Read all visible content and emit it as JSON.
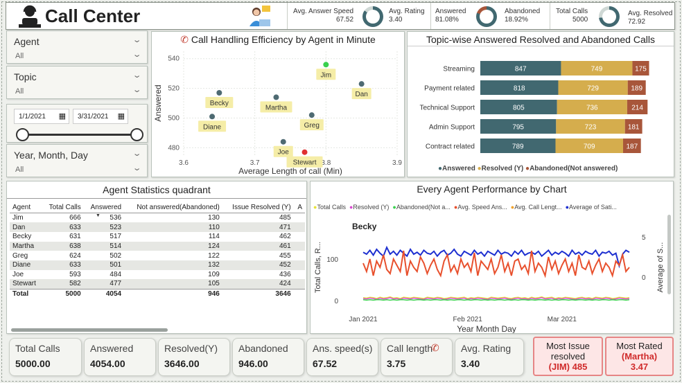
{
  "header": {
    "title": "Call Center",
    "kpis": [
      {
        "label": "Avg. Answer Speed",
        "value": "67.52",
        "label2": "Avg. Rating",
        "value2": "3.40"
      },
      {
        "label": "Answered",
        "value": "81.08%",
        "label2": "Abandoned",
        "value2": "18.92%"
      },
      {
        "label": "Total Calls",
        "value": "5000",
        "label2": "Avg. Resolved",
        "value2": "72.92"
      }
    ]
  },
  "filters": {
    "agent": {
      "title": "Agent",
      "value": "All"
    },
    "topic": {
      "title": "Topic",
      "value": "All"
    },
    "date_start": "1/1/2021",
    "date_end": "3/31/2021",
    "ymd": {
      "title": "Year, Month, Day",
      "value": "All"
    }
  },
  "scatter": {
    "title": "Call Handling Efficiency by Agent in Minute",
    "xlabel": "Average Length of call (Min)",
    "ylabel": "Answered",
    "xticks": [
      "3.6",
      "3.7",
      "3.8",
      "3.9"
    ],
    "yticks": [
      "480",
      "500",
      "520",
      "540"
    ]
  },
  "topic_chart": {
    "title": "Topic-wise Answered Resolved and Abandoned Calls",
    "legend": [
      "Answered",
      "Resolved (Y)",
      "Abandoned(Not answered)"
    ],
    "colors": [
      "#416870",
      "#d5ad4d",
      "#a8563a"
    ]
  },
  "agent_table": {
    "title": "Agent Statistics quadrant",
    "columns": [
      "Agent",
      "Total Calls",
      "Answered",
      "Not answered(Abandoned)",
      "Issue Resolved (Y)",
      "A"
    ],
    "rows": [
      [
        "Jim",
        "666",
        "536",
        "130",
        "485"
      ],
      [
        "Dan",
        "633",
        "523",
        "110",
        "471"
      ],
      [
        "Becky",
        "631",
        "517",
        "114",
        "462"
      ],
      [
        "Martha",
        "638",
        "514",
        "124",
        "461"
      ],
      [
        "Greg",
        "624",
        "502",
        "122",
        "455"
      ],
      [
        "Diane",
        "633",
        "501",
        "132",
        "452"
      ],
      [
        "Joe",
        "593",
        "484",
        "109",
        "436"
      ],
      [
        "Stewart",
        "582",
        "477",
        "105",
        "424"
      ]
    ],
    "total": [
      "Total",
      "5000",
      "4054",
      "946",
      "3646"
    ]
  },
  "perf_chart": {
    "title": "Every Agent Performance by Chart",
    "legend": [
      {
        "name": "Total Calls",
        "color": "#e8e33a"
      },
      {
        "name": "Resolved (Y)",
        "color": "#d84ed0"
      },
      {
        "name": "Abandoned(Not a...",
        "color": "#3ad04e"
      },
      {
        "name": "Avg. Speed Ans...",
        "color": "#e8502d"
      },
      {
        "name": "Avg. Call Lengt...",
        "color": "#f0a22c"
      },
      {
        "name": "Average of Sati...",
        "color": "#1d2fd0"
      }
    ],
    "agent_label": "Becky",
    "ylabel_left": "Total Calls, R...",
    "ylabel_right": "Average of S...",
    "xlabel": "Year Month Day",
    "xticks": [
      "Jan 2021",
      "Feb 2021",
      "Mar 2021"
    ],
    "yticks_left": [
      "100",
      "0"
    ],
    "yticks_right": [
      "5",
      "0"
    ]
  },
  "bottom_kpis": [
    {
      "label": "Total Calls",
      "value": "5000.00"
    },
    {
      "label": "Answered",
      "value": "4054.00"
    },
    {
      "label": "Resolved(Y)",
      "value": "3646.00"
    },
    {
      "label": "Abandoned",
      "value": "946.00"
    },
    {
      "label": "Ans. speed(s)",
      "value": "67.52"
    },
    {
      "label": "Call length",
      "value": "3.75"
    },
    {
      "label": "Avg. Rating",
      "value": "3.40"
    }
  ],
  "highlights": [
    {
      "line1": "Most Issue",
      "line2": "resolved",
      "value": "(JIM) 485"
    },
    {
      "line1": "Most Rated",
      "line2": "(Martha)",
      "value": "3.47"
    }
  ],
  "chart_data": [
    {
      "type": "scatter",
      "title": "Call Handling Efficiency by Agent in Minute",
      "xlabel": "Average Length of call (Min)",
      "ylabel": "Answered",
      "xlim": [
        3.6,
        3.9
      ],
      "ylim": [
        475,
        545
      ],
      "points": [
        {
          "name": "Jim",
          "x": 3.8,
          "y": 536,
          "color": "#3ad04e"
        },
        {
          "name": "Dan",
          "x": 3.85,
          "y": 523,
          "color": "#4e6a72"
        },
        {
          "name": "Becky",
          "x": 3.65,
          "y": 517,
          "color": "#4e6a72"
        },
        {
          "name": "Martha",
          "x": 3.73,
          "y": 514,
          "color": "#4e6a72"
        },
        {
          "name": "Greg",
          "x": 3.78,
          "y": 502,
          "color": "#4e6a72"
        },
        {
          "name": "Diane",
          "x": 3.64,
          "y": 501,
          "color": "#4e6a72"
        },
        {
          "name": "Joe",
          "x": 3.74,
          "y": 484,
          "color": "#4e6a72"
        },
        {
          "name": "Stewart",
          "x": 3.77,
          "y": 477,
          "color": "#e03131"
        }
      ]
    },
    {
      "type": "bar",
      "stacked": true,
      "orientation": "horizontal",
      "title": "Topic-wise Answered Resolved and Abandoned Calls",
      "categories": [
        "Streaming",
        "Payment related",
        "Technical Support",
        "Admin Support",
        "Contract related"
      ],
      "series": [
        {
          "name": "Answered",
          "values": [
            847,
            818,
            805,
            795,
            789
          ]
        },
        {
          "name": "Resolved (Y)",
          "values": [
            749,
            729,
            736,
            723,
            709
          ]
        },
        {
          "name": "Abandoned(Not answered)",
          "values": [
            175,
            189,
            214,
            181,
            187
          ]
        }
      ]
    },
    {
      "type": "line",
      "title": "Every Agent Performance by Chart",
      "xlabel": "Year Month Day",
      "series": [
        {
          "name": "Average of Sati...",
          "axis": "right",
          "values": [
            3.7,
            3.5,
            3.9,
            3.4,
            4.0,
            3.6,
            3.3,
            4.2,
            3.5,
            3.8,
            3.4,
            3.9,
            3.6,
            3.3,
            4.0,
            3.5,
            3.7,
            3.4,
            3.9,
            3.6,
            3.5,
            3.8,
            3.3,
            3.7,
            3.9,
            3.4,
            3.6,
            4.0,
            3.5,
            3.3,
            3.8,
            3.6,
            3.4,
            3.9,
            3.5,
            3.7,
            3.3,
            3.8,
            3.6,
            3.4,
            3.9,
            3.5,
            3.7,
            3.6,
            3.3,
            3.8,
            3.5,
            3.9,
            3.4,
            3.6,
            3.7,
            3.5,
            3.8,
            3.3,
            3.6,
            3.9,
            3.4,
            3.7,
            3.5,
            3.8,
            3.6,
            3.3,
            3.9,
            3.5,
            3.7,
            3.4,
            3.8,
            3.6,
            3.5,
            3.9,
            3.3,
            3.7,
            3.6,
            3.8,
            3.4,
            3.6,
            2.3,
            3.5,
            3.9,
            3.7
          ]
        },
        {
          "name": "Avg. Speed Ans...",
          "axis": "left",
          "values": [
            90,
            70,
            100,
            60,
            95,
            80,
            110,
            75,
            65,
            100,
            85,
            70,
            120,
            60,
            95,
            80,
            70,
            105,
            90,
            65,
            85,
            100,
            75,
            60,
            95,
            110,
            70,
            85,
            65,
            100,
            80,
            90,
            70,
            115,
            60,
            95,
            85,
            75,
            100,
            65,
            80,
            110,
            70,
            90,
            60,
            95,
            100,
            75,
            85,
            65,
            120,
            70,
            90,
            80,
            60,
            105,
            75,
            95,
            65,
            85,
            100,
            70,
            90,
            60,
            110,
            80,
            75,
            95,
            65,
            85,
            100,
            70,
            90,
            80,
            60,
            95,
            85,
            110,
            70,
            80
          ]
        },
        {
          "name": "Total Calls",
          "axis": "left",
          "values": [
            7,
            6,
            8,
            7,
            5,
            8,
            6,
            7,
            9,
            6,
            7,
            5,
            8,
            7,
            6,
            8,
            7,
            6,
            5,
            8,
            7,
            6,
            8,
            7,
            5,
            6,
            8,
            7,
            6,
            7,
            8,
            5,
            7,
            6,
            8,
            7,
            6,
            5,
            8,
            7,
            6,
            7,
            8,
            6,
            5,
            7,
            8,
            6,
            7,
            5,
            8,
            6,
            7,
            9,
            6,
            7,
            8,
            5,
            7,
            6,
            8,
            7,
            6,
            5,
            7,
            8,
            6,
            7,
            5,
            8,
            7,
            6,
            8,
            7,
            5,
            6,
            8,
            7,
            6,
            7
          ]
        },
        {
          "name": "Resolved (Y)",
          "axis": "left",
          "values": [
            5,
            4,
            6,
            5,
            3,
            6,
            4,
            5,
            7,
            4,
            5,
            3,
            6,
            5,
            4,
            6,
            5,
            4,
            3,
            6,
            5,
            4,
            6,
            5,
            3,
            4,
            6,
            5,
            4,
            5,
            6,
            3,
            5,
            4,
            6,
            5,
            4,
            3,
            6,
            5,
            4,
            5,
            6,
            4,
            3,
            5,
            6,
            4,
            5,
            3,
            6,
            4,
            5,
            7,
            4,
            5,
            6,
            3,
            5,
            4,
            6,
            5,
            4,
            3,
            5,
            6,
            4,
            5,
            3,
            6,
            5,
            4,
            6,
            5,
            3,
            4,
            6,
            5,
            4,
            5
          ]
        },
        {
          "name": "Abandoned(Not a...",
          "axis": "left",
          "values": [
            2,
            1,
            2,
            1,
            2,
            2,
            1,
            2,
            1,
            2,
            1,
            2,
            2,
            1,
            2,
            1,
            2,
            2,
            1,
            2,
            1,
            2,
            2,
            1,
            2,
            1,
            2,
            1,
            2,
            2,
            1,
            2,
            1,
            2,
            2,
            1,
            2,
            1,
            2,
            1,
            2,
            2,
            1,
            2,
            1,
            2,
            1,
            2,
            2,
            1,
            2,
            1,
            2,
            2,
            1,
            2,
            1,
            2,
            1,
            2,
            2,
            1,
            2,
            1,
            2,
            2,
            1,
            2,
            1,
            2,
            1,
            2,
            2,
            1,
            2,
            1,
            2,
            2,
            1,
            2
          ]
        }
      ]
    }
  ]
}
